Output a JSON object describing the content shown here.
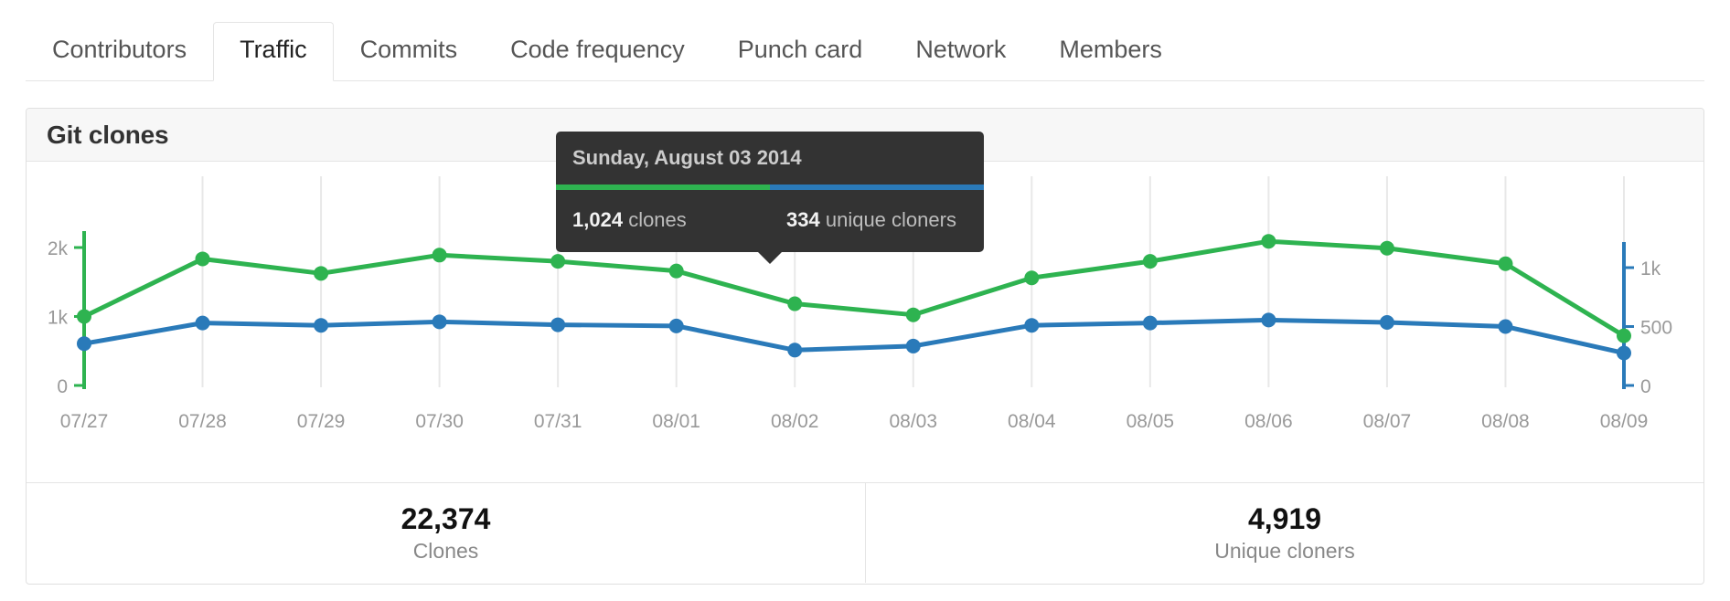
{
  "tabs": [
    {
      "label": "Contributors",
      "selected": false
    },
    {
      "label": "Traffic",
      "selected": true
    },
    {
      "label": "Commits",
      "selected": false
    },
    {
      "label": "Code frequency",
      "selected": false
    },
    {
      "label": "Punch card",
      "selected": false
    },
    {
      "label": "Network",
      "selected": false
    },
    {
      "label": "Members",
      "selected": false
    }
  ],
  "card": {
    "title": "Git clones"
  },
  "footer": {
    "stats": [
      {
        "value": "22,374",
        "label": "Clones"
      },
      {
        "value": "4,919",
        "label": "Unique cloners"
      }
    ]
  },
  "tooltip": {
    "date": "Sunday, August 03 2014",
    "clones_value": "1,024",
    "clones_label": "clones",
    "unique_value": "334",
    "unique_label": "unique cloners"
  },
  "colors": {
    "clones_green": "#2eb350",
    "unique_blue": "#2a7ab9",
    "gridline": "#e8e8e8",
    "axis_text": "#999999",
    "tooltip_bg": "#333333"
  },
  "chart_data": {
    "type": "line",
    "title": "Git clones",
    "xlabel": "",
    "ylabel": "",
    "grid": true,
    "legend": "none",
    "categories": [
      "07/27",
      "07/28",
      "07/29",
      "07/30",
      "07/31",
      "08/01",
      "08/02",
      "08/03",
      "08/04",
      "08/05",
      "08/06",
      "08/07",
      "08/08",
      "08/09"
    ],
    "left_axis": {
      "name": "clones",
      "ticks": [
        "0",
        "1k",
        "2k"
      ],
      "tick_values": [
        0,
        1000,
        2000
      ],
      "ylim": [
        0,
        2200
      ],
      "color": "#2eb350"
    },
    "right_axis": {
      "name": "unique cloners",
      "ticks": [
        "0",
        "500",
        "1k"
      ],
      "tick_values": [
        0,
        500,
        1000
      ],
      "ylim": [
        0,
        1100
      ],
      "color": "#2a7ab9"
    },
    "series": [
      {
        "name": "clones",
        "axis": "left",
        "color": "#2eb350",
        "values": [
          1000,
          1835,
          1625,
          1890,
          1800,
          1660,
          1185,
          1024,
          1560,
          1800,
          2090,
          1990,
          1765,
          720
        ]
      },
      {
        "name": "unique cloners",
        "axis": "right",
        "color": "#2a7ab9",
        "values": [
          355,
          530,
          510,
          540,
          515,
          505,
          300,
          334,
          510,
          530,
          555,
          535,
          500,
          275
        ]
      }
    ],
    "annotations": [
      {
        "x": "08/03",
        "type": "tooltip",
        "date": "Sunday, August 03 2014",
        "clones": 1024,
        "unique_cloners": 334
      }
    ]
  }
}
